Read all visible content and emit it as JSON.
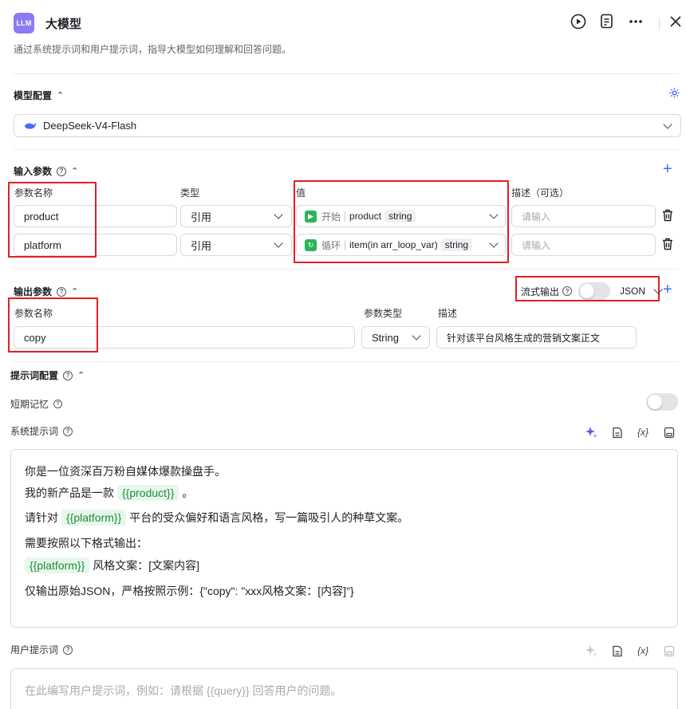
{
  "header": {
    "logo_text": "LLM",
    "title": "大模型",
    "description": "通过系统提示词和用户提示词，指导大模型如何理解和回答问题。",
    "icons": [
      "play-icon",
      "document-icon",
      "more-icon",
      "close-icon"
    ]
  },
  "model_config": {
    "label": "模型配置",
    "model_name": "DeepSeek-V4-Flash",
    "settings_icon": "gear-icon"
  },
  "inputs": {
    "label": "输入参数",
    "col_name": "参数名称",
    "col_type": "类型",
    "col_value": "值",
    "col_desc": "描述（可选）",
    "rows": [
      {
        "name": "product",
        "type": "引用",
        "source": "开始",
        "var": "product",
        "var_type": "string",
        "desc_placeholder": "请输入"
      },
      {
        "name": "platform",
        "type": "引用",
        "source": "循环",
        "var": "item(in arr_loop_var)",
        "var_type": "string",
        "desc_placeholder": "请输入"
      }
    ]
  },
  "outputs": {
    "label": "输出参数",
    "stream_label": "流式输出",
    "format": "JSON",
    "col_name": "参数名称",
    "col_type": "参数类型",
    "col_desc": "描述",
    "rows": [
      {
        "name": "copy",
        "type": "String",
        "desc": "针对该平台风格生成的营销文案正文"
      }
    ]
  },
  "prompt": {
    "label": "提示词配置",
    "memory_label": "短期记忆",
    "system_label": "系统提示词",
    "system_lines": {
      "l1": "你是一位资深百万粉自媒体爆款操盘手。",
      "l2a": "我的新产品是一款",
      "l2chip": "{{product}}",
      "l2b": "。",
      "l3a": "请针对",
      "l3chip": "{{platform}}",
      "l3b": "平台的受众偏好和语言风格，写一篇吸引人的种草文案。",
      "l4": "需要按照以下格式输出：",
      "l5chip": "{{platform}}",
      "l5b": "风格文案：[文案内容]",
      "l6": "仅输出原始JSON，严格按照示例：{\"copy\": \"xxx风格文案：[内容]\"}"
    },
    "user_label": "用户提示词",
    "user_placeholder": "在此编写用户提示词，例如：请根据 {{query}} 回答用户的问题。",
    "toolbar_var": "{x}"
  },
  "colors": {
    "accent": "#3b6bff",
    "highlight": "#e41e25",
    "chip_bg": "#e8f7ec",
    "chip_text": "#1a8f3a"
  }
}
